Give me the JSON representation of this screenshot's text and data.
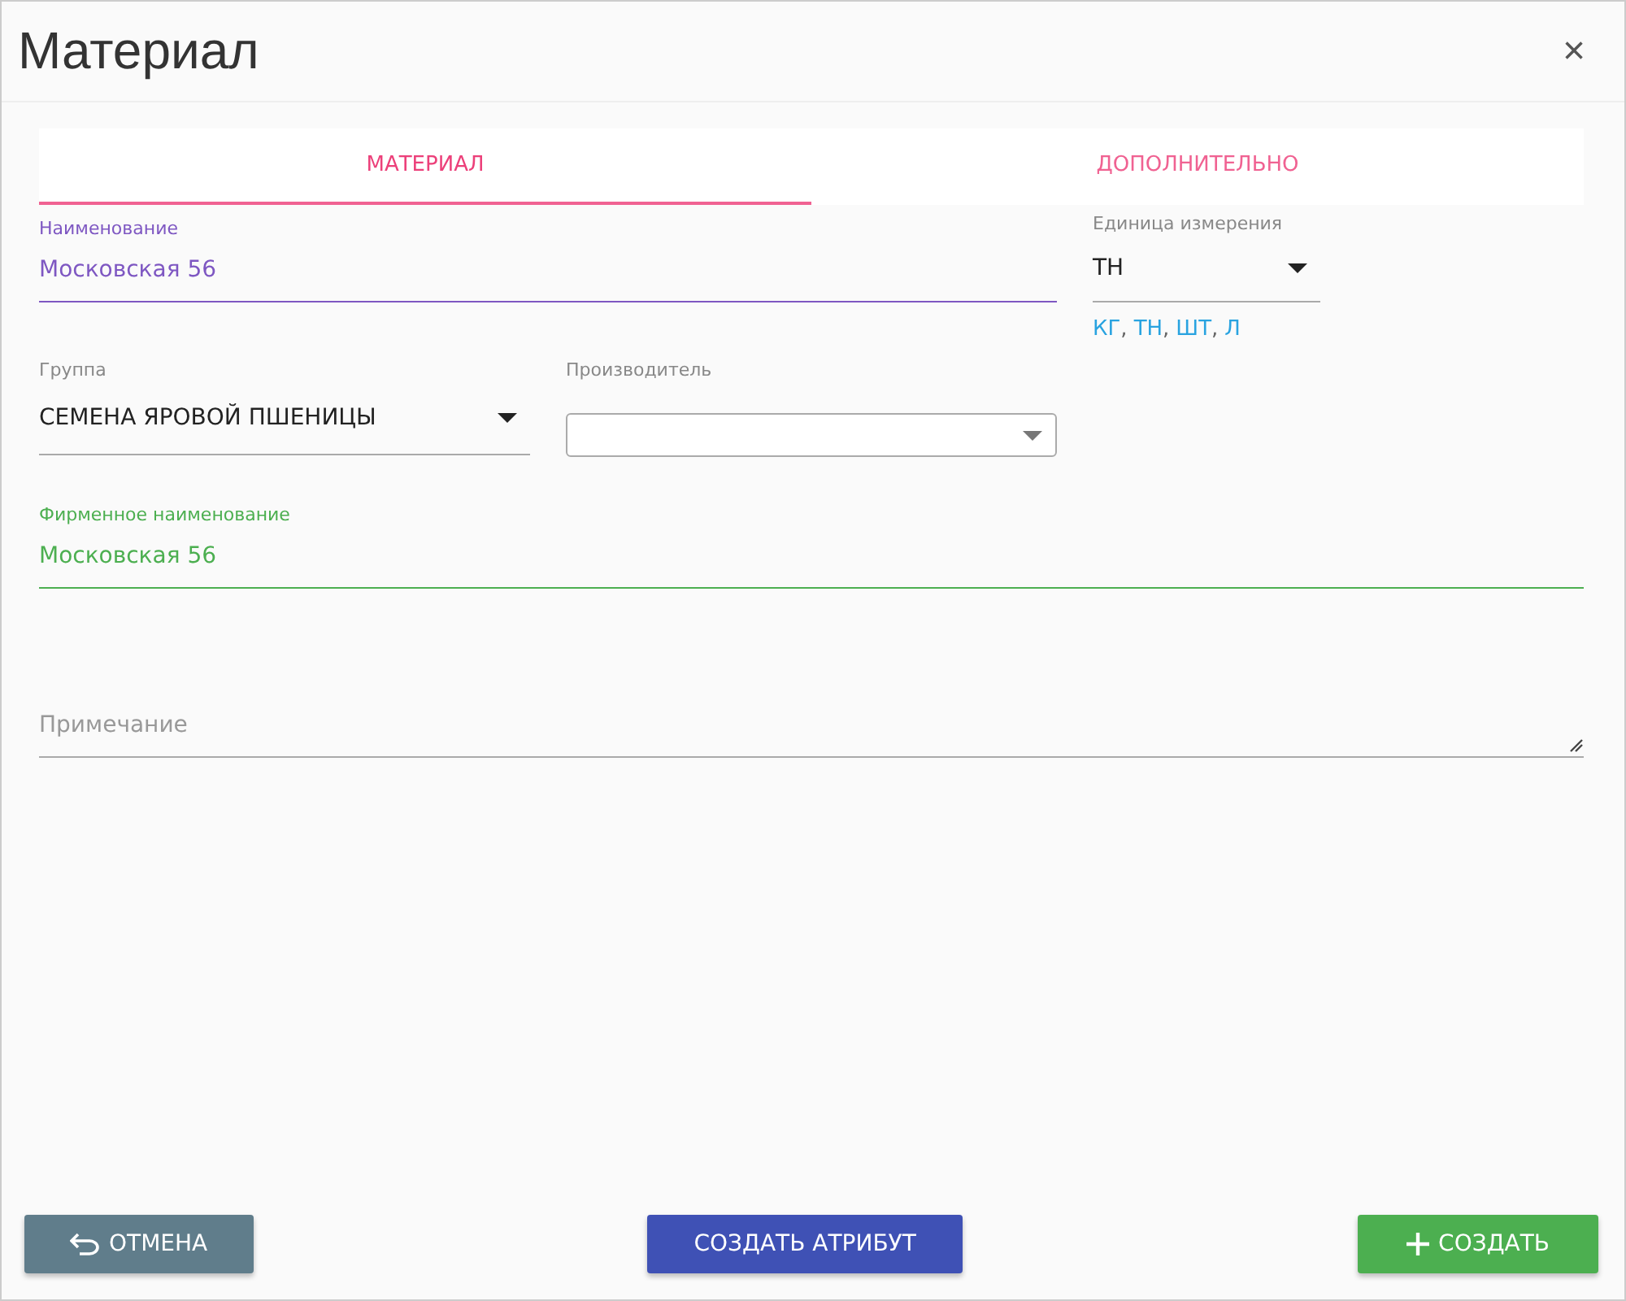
{
  "dialog": {
    "title": "Материал",
    "close": "×"
  },
  "tabs": [
    {
      "label": "МАТЕРИАЛ",
      "selected": true
    },
    {
      "label": "ДОПОЛНИТЕЛЬНО",
      "selected": false
    }
  ],
  "name_field": {
    "label": "Наименование",
    "value": "Московская 56",
    "focused": true
  },
  "unit_field": {
    "label": "Единица измерения",
    "value": "ТН",
    "options": [
      "КГ",
      "ТН",
      "ШТ",
      "Л"
    ],
    "separator": ","
  },
  "group_field": {
    "label": "Группа",
    "value": "СЕМЕНА ЯРОВОЙ ПШЕНИЦЫ"
  },
  "manufacturer_field": {
    "label": "Производитель"
  },
  "brand_field": {
    "label": "Фирменное наименование",
    "value": "Московская 56",
    "valid": true
  },
  "note_field": {
    "placeholder": "Примечание"
  },
  "buttons": [
    {
      "label": "ОТМЕНА",
      "kind": "cancel"
    },
    {
      "label": "СОЗДАТЬ АТРИБУТ",
      "kind": "secondary"
    },
    {
      "label": "СОЗДАТЬ",
      "kind": "primary"
    }
  ]
}
